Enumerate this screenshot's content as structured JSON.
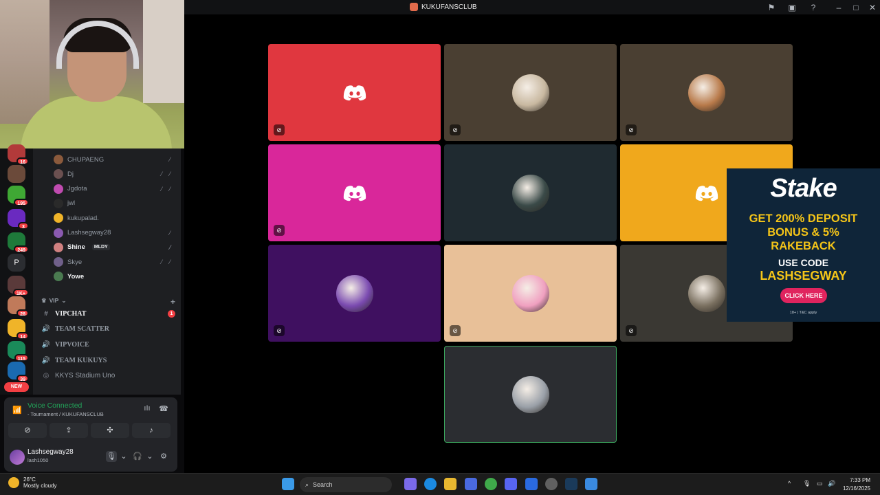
{
  "window": {
    "title": "KUKUFANSCLUB"
  },
  "members": [
    {
      "name": "CHUPAENG",
      "icons": "⁄",
      "color": "#8b5a3c"
    },
    {
      "name": "Dj",
      "icons": "⁄ ⁄",
      "color": "#6b5050"
    },
    {
      "name": "Jgdota",
      "icons": "⁄ ⁄",
      "color": "#c04bb0"
    },
    {
      "name": "jwl",
      "icons": "",
      "color": "#2a2a2a"
    },
    {
      "name": "kukupalad.",
      "icons": "",
      "color": "#f0b429"
    },
    {
      "name": "Lashsegway28",
      "icons": "⁄",
      "color": "#8a5ab0"
    },
    {
      "name": "Shine",
      "badge": "MLDY",
      "icons": "⁄",
      "color": "#d08080"
    },
    {
      "name": "Skye",
      "icons": "⁄ ⁄",
      "color": "#70608a"
    },
    {
      "name": "Yowe",
      "icons": "",
      "color": "#4a7a50"
    }
  ],
  "category": {
    "label": "VIP",
    "plus": "+"
  },
  "channels": [
    {
      "name": "VIPCHAT",
      "icon": "#",
      "unread": "1"
    },
    {
      "name": "TEAM SCATTER",
      "icon": "🔊"
    },
    {
      "name": "VIPVOICE",
      "icon": "🔊"
    },
    {
      "name": "TEAM KUKUYS",
      "icon": "🔊"
    },
    {
      "name": "KKYS Stadium Uno",
      "icon": "◎"
    }
  ],
  "servers": [
    {
      "label": "",
      "badge": "16",
      "color": "#b23a3a"
    },
    {
      "label": "",
      "badge": "",
      "color": "#6b4a3a"
    },
    {
      "label": "",
      "badge": "195",
      "color": "#3fa834"
    },
    {
      "label": "",
      "badge": "3",
      "color": "#6a2ac0"
    },
    {
      "label": "",
      "badge": "249",
      "color": "#1e7a3a"
    },
    {
      "label": "P",
      "badge": "",
      "color": "#2b2d31"
    },
    {
      "label": "",
      "badge": "1K+",
      "color": "#5a3a3a"
    },
    {
      "label": "",
      "badge": "28",
      "color": "#c07a5a"
    },
    {
      "label": "",
      "badge": "14",
      "color": "#f0b429"
    },
    {
      "label": "",
      "badge": "115",
      "color": "#1a8a5a"
    },
    {
      "label": "",
      "badge": "39",
      "color": "#1a6ab0"
    }
  ],
  "new_badge": "NEW",
  "voice": {
    "status": "Voice Connected",
    "channel": "- Tournament / KUKUFANSCLUB"
  },
  "user": {
    "name": "Lashsegway28",
    "tag": "lash1050"
  },
  "tiles": [
    {
      "kind": "logo",
      "bg": "#e0373f",
      "muted": true
    },
    {
      "kind": "avatar",
      "bg": "#4a3f32",
      "avatar_color": "#c8b8a0",
      "muted": true
    },
    {
      "kind": "avatar",
      "bg": "#4a3f32",
      "avatar_color": "#b87a4a",
      "muted": true
    },
    {
      "kind": "logo",
      "bg": "#d9279a",
      "muted": true
    },
    {
      "kind": "avatar",
      "bg": "#1f2a30",
      "avatar_color": "#3a4a48",
      "muted": false
    },
    {
      "kind": "logo",
      "bg": "#f0a81c",
      "muted": false
    },
    {
      "kind": "avatar",
      "bg": "#3f1060",
      "avatar_color": "#7a4ab0",
      "muted": true
    },
    {
      "kind": "avatar",
      "bg": "#e8c098",
      "avatar_color": "#f0a0c0",
      "muted": true
    },
    {
      "kind": "avatar",
      "bg": "#3a3833",
      "avatar_color": "#7a7060",
      "muted": true
    },
    {
      "kind": "avatar",
      "bg": "#2b2d31",
      "avatar_color": "#9aa0a8",
      "muted": false,
      "speaking": true
    }
  ],
  "ad": {
    "brand": "Stake",
    "line1": "GET 200% DEPOSIT",
    "line2": "BONUS & 5%",
    "line3": "RAKEBACK",
    "use_code": "USE CODE",
    "code": "LASHSEGWAY",
    "cta": "CLICK HERE",
    "fine": "18+ | T&C apply"
  },
  "taskbar": {
    "temp": "26°C",
    "condition": "Mostly cloudy",
    "search_placeholder": "Search",
    "time": "7:33 PM",
    "date": "12/16/2025"
  },
  "colors": {
    "speaking": "#3ba55d",
    "danger": "#f23f43",
    "voice_green": "#23a55a"
  }
}
